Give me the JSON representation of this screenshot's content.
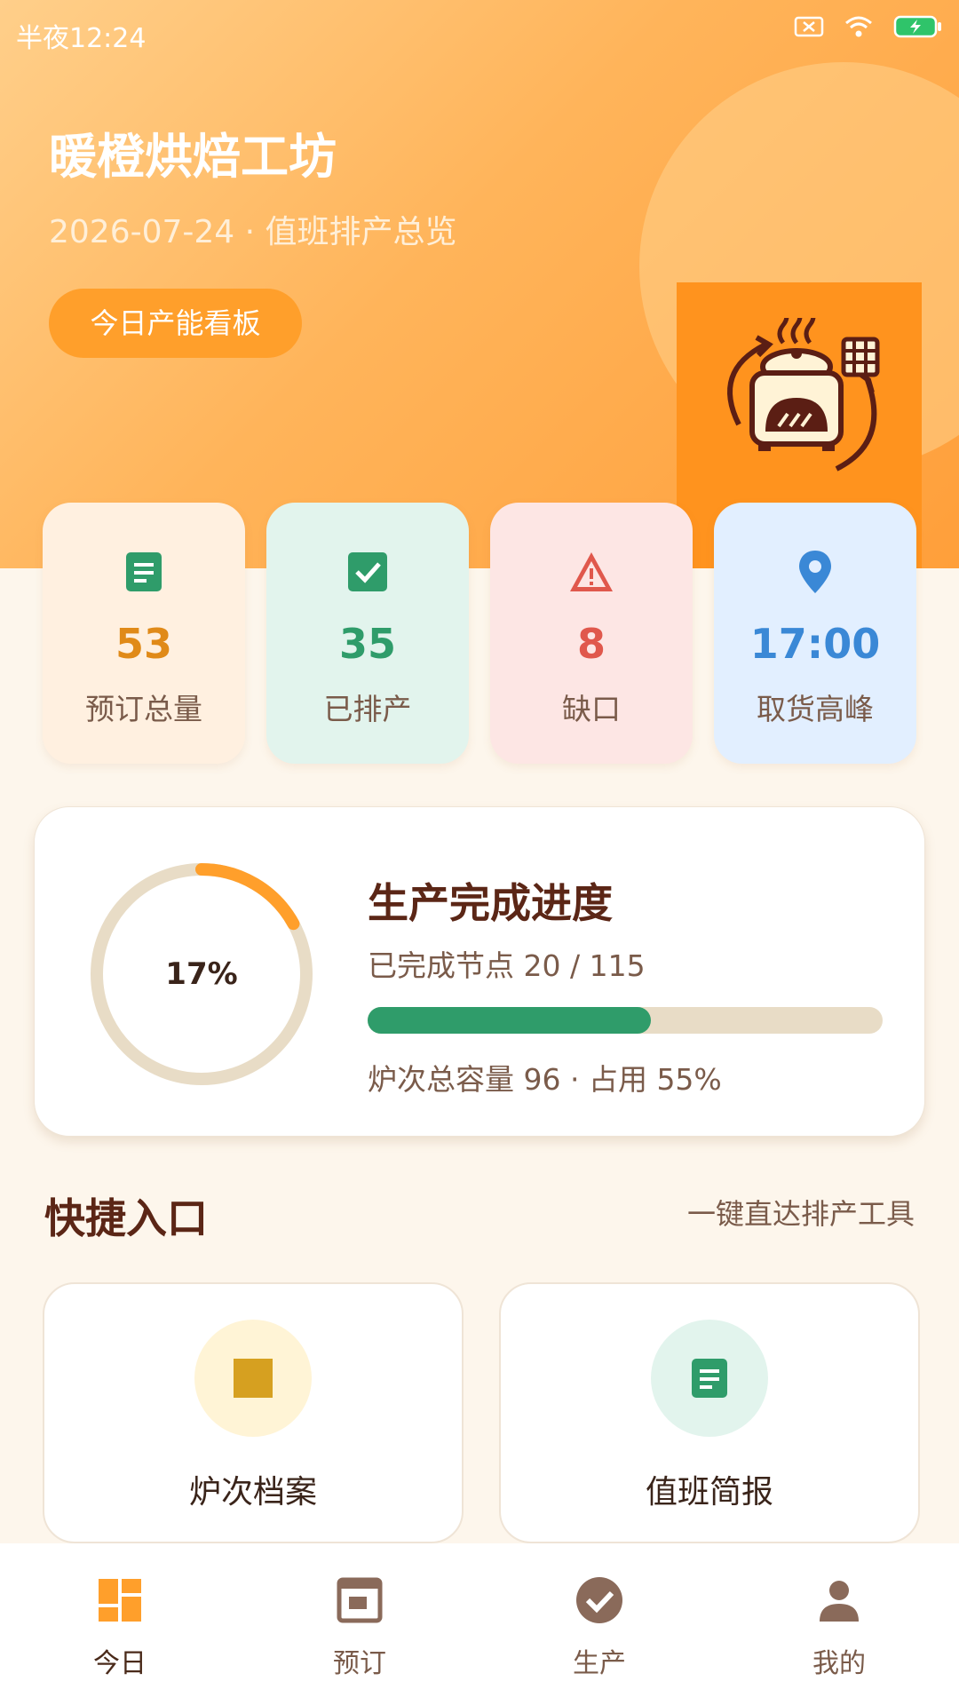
{
  "status_bar": {
    "time": "半夜12:24"
  },
  "header": {
    "title": "暖橙烘焙工坊",
    "subtitle": "2026-07-24 · 值班排产总览",
    "board_button": "今日产能看板"
  },
  "stats": [
    {
      "value": "53",
      "label": "预订总量",
      "icon": "document-icon",
      "bg": "#fff0e0",
      "color": "#e08a18"
    },
    {
      "value": "35",
      "label": "已排产",
      "icon": "check-box-icon",
      "bg": "#e2f4ed",
      "color": "#2f9c6a"
    },
    {
      "value": "8",
      "label": "缺口",
      "icon": "warning-icon",
      "bg": "#fde6e4",
      "color": "#e0584c"
    },
    {
      "value": "17:00",
      "label": "取货高峰",
      "icon": "location-pin-icon",
      "bg": "#e2efff",
      "color": "#3a88d6"
    }
  ],
  "progress": {
    "title": "生产完成进度",
    "ring_label": "17%",
    "ring_percent": 17,
    "completed_text": "已完成节点 20 / 115",
    "bar_percent": 55,
    "capacity_text": "炉次总容量 96 · 占用 55%"
  },
  "quick": {
    "title": "快捷入口",
    "link": "一键直达排产工具",
    "items": [
      {
        "label": "炉次档案",
        "icon": "square-icon"
      },
      {
        "label": "值班简报",
        "icon": "document-icon"
      }
    ]
  },
  "tabs": [
    {
      "label": "今日",
      "icon": "dashboard-icon",
      "active": true
    },
    {
      "label": "预订",
      "icon": "calendar-icon",
      "active": false
    },
    {
      "label": "生产",
      "icon": "check-circle-icon",
      "active": false
    },
    {
      "label": "我的",
      "icon": "person-icon",
      "active": false
    }
  ],
  "colors": {
    "accent_orange": "#ff9f2b",
    "green": "#2f9c6a",
    "brown_text": "#5b2616"
  }
}
